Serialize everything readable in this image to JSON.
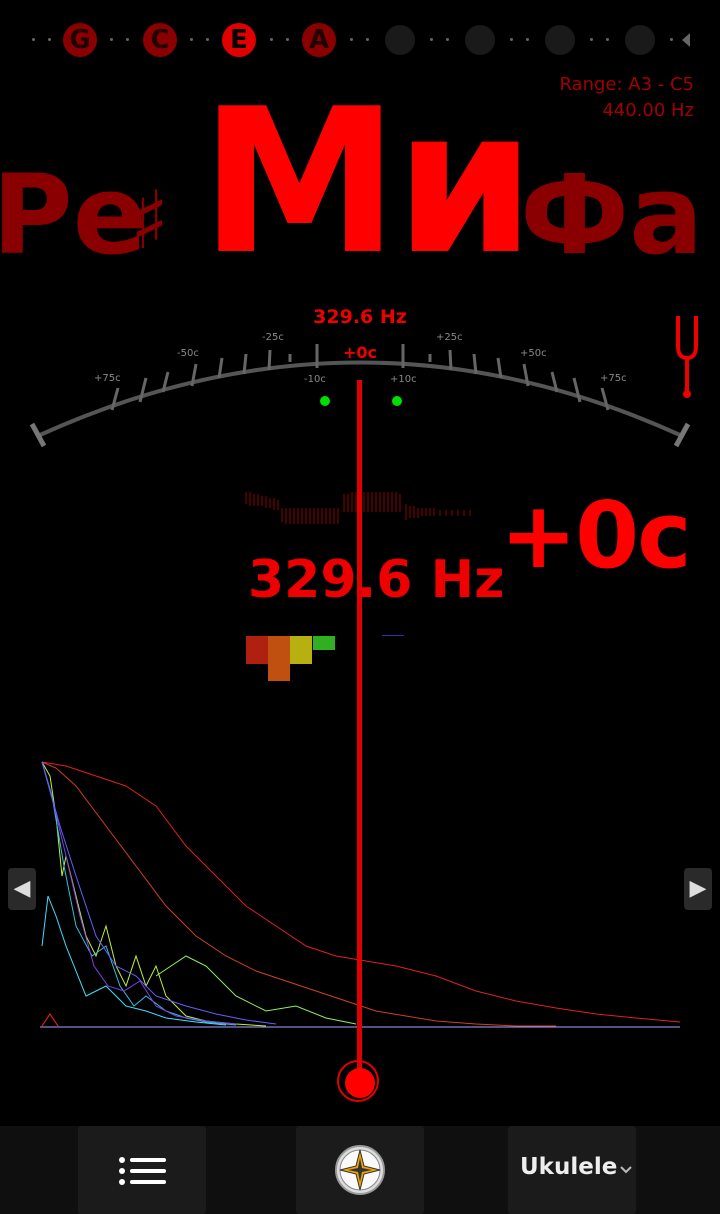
{
  "strings": {
    "notes": [
      {
        "label": "G",
        "active": false
      },
      {
        "label": "C",
        "active": false
      },
      {
        "label": "E",
        "active": true
      },
      {
        "label": "A",
        "active": false
      }
    ]
  },
  "range": {
    "label": "Range: A3 - C5",
    "reference": "440.00 Hz"
  },
  "note_display": {
    "previous": "Ре",
    "previous_accidental": "♯",
    "current": "Ми",
    "next": "Фа"
  },
  "meter": {
    "frequency": "329.6 Hz",
    "cents": "+0c",
    "scale_labels": [
      "+75c",
      "-50c",
      "-25c",
      "-10c",
      "+10c",
      "+25c",
      "+50c",
      "+75c"
    ]
  },
  "readout": {
    "frequency": "329.6 Hz",
    "cents": "+0c"
  },
  "navigation": {
    "left_arrow": "◀",
    "right_arrow": "▶"
  },
  "toolbar": {
    "instrument": "Ukulele"
  },
  "colors": {
    "accent": "#ff0000",
    "dim_accent": "#8a0000",
    "in_tune_indicator": "#00e000"
  }
}
